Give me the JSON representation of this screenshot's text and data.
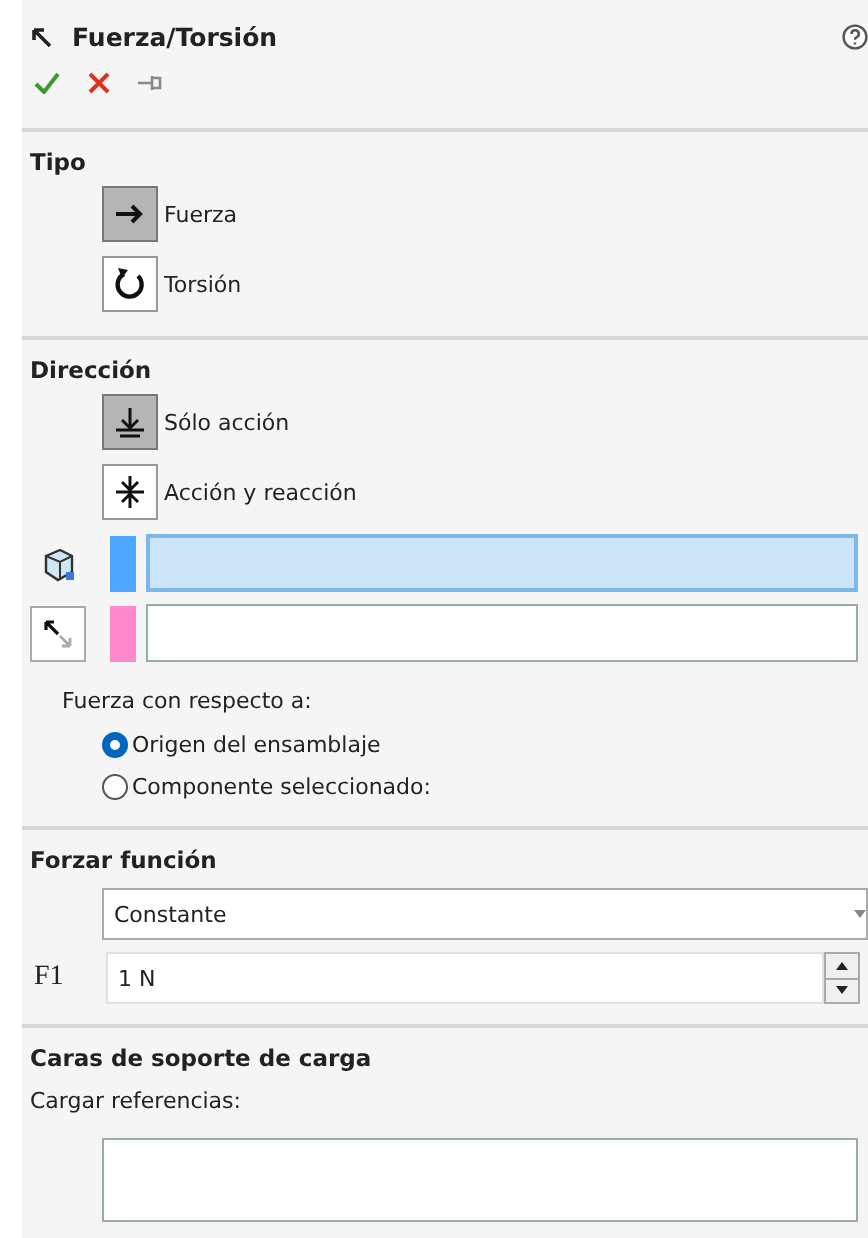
{
  "header": {
    "title": "Fuerza/Torsión"
  },
  "tipo": {
    "title": "Tipo",
    "options": [
      {
        "kind": "force",
        "label": "Fuerza",
        "selected": true
      },
      {
        "kind": "torque",
        "label": "Torsión",
        "selected": false
      }
    ]
  },
  "direccion": {
    "title": "Dirección",
    "options": [
      {
        "kind": "action",
        "label": "Sólo acción",
        "selected": true
      },
      {
        "kind": "reaction",
        "label": "Acción y reacción",
        "selected": false
      }
    ],
    "selection_fields": [
      {
        "kind": "faces",
        "color": "#4da6ff",
        "active": true
      },
      {
        "kind": "direction",
        "color": "#ff88cc",
        "active": false
      }
    ],
    "relative_label": "Fuerza con respecto a:",
    "radios": [
      {
        "label": "Origen del ensamblaje",
        "selected": true
      },
      {
        "label": "Componente seleccionado:",
        "selected": false
      }
    ]
  },
  "forzar": {
    "title": "Forzar función",
    "dropdown": "Constante",
    "symbol": "F1",
    "value": "1 N"
  },
  "caras": {
    "title": "Caras de soporte de carga",
    "label": "Cargar referencias:"
  }
}
